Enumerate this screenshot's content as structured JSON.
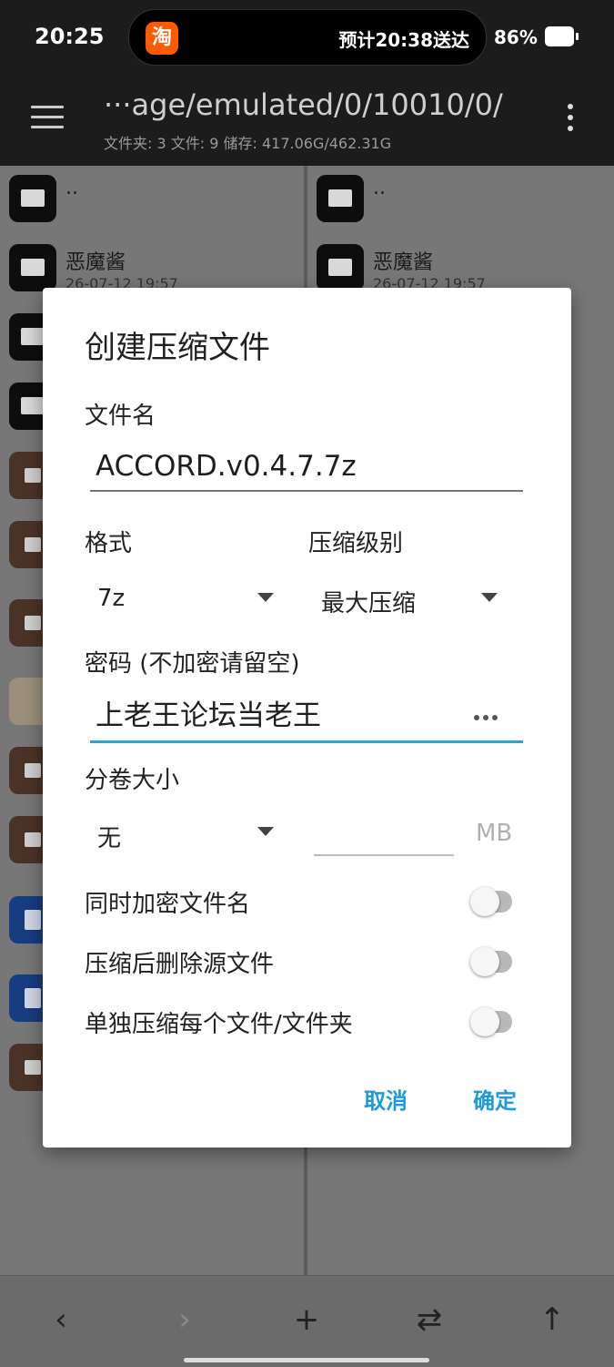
{
  "status_bar": {
    "time": "20:25",
    "notification_icon": "淘",
    "notification_text": "预计20:38送达",
    "battery": "86%"
  },
  "app_bar": {
    "path": "···age/emulated/0/10010/0/",
    "summary": "文件夹: 3  文件: 9  储存: 417.06G/462.31G"
  },
  "left_pane": {
    "items": [
      {
        "name": "..",
        "date": "",
        "type": "folder"
      },
      {
        "name": "恶魔酱",
        "date": "26-07-12 19:57",
        "type": "folder"
      },
      {
        "name": "",
        "date": "",
        "type": "folder"
      },
      {
        "name": "",
        "date": "",
        "type": "folder"
      },
      {
        "name": "",
        "date": "",
        "type": "archive"
      },
      {
        "name": "",
        "date": "",
        "type": "archive"
      },
      {
        "name": "",
        "date": "",
        "type": "archive"
      },
      {
        "name": "",
        "date": "",
        "type": "image"
      },
      {
        "name": "",
        "date": "",
        "type": "archive"
      },
      {
        "name": "",
        "date": "",
        "type": "archive"
      },
      {
        "name": "",
        "date": "",
        "type": "doc"
      },
      {
        "name": "",
        "date": "",
        "type": "doc"
      },
      {
        "name": "",
        "date": "",
        "type": "archive"
      }
    ]
  },
  "right_pane": {
    "items": [
      {
        "name": "..",
        "date": "",
        "type": "folder"
      },
      {
        "name": "恶魔酱",
        "date": "26-07-12 19:57",
        "type": "folder"
      }
    ]
  },
  "dialog": {
    "title": "创建压缩文件",
    "filename_label": "文件名",
    "filename_value": "ACCORD.v0.4.7.7z",
    "format_label": "格式",
    "format_value": "7z",
    "level_label": "压缩级别",
    "level_value": "最大压缩",
    "password_label": "密码 (不加密请留空)",
    "password_value": "上老王论坛当老王",
    "volume_label": "分卷大小",
    "volume_value": "无",
    "volume_unit": "MB",
    "toggle_encrypt_names": "同时加密文件名",
    "toggle_delete_source": "压缩后删除源文件",
    "toggle_each_separately": "单独压缩每个文件/文件夹",
    "cancel": "取消",
    "ok": "确定"
  },
  "toggles_state": {
    "encrypt_names": false,
    "delete_source": false,
    "each_separately": false
  },
  "colors": {
    "accent": "#1e9bd7",
    "active_underline": "#29a3d8",
    "app_bar": "#1c1c1c"
  },
  "bottom_bar": {
    "back": "‹",
    "forward": "›",
    "add": "+",
    "swap": "⇄",
    "up": "↑"
  }
}
